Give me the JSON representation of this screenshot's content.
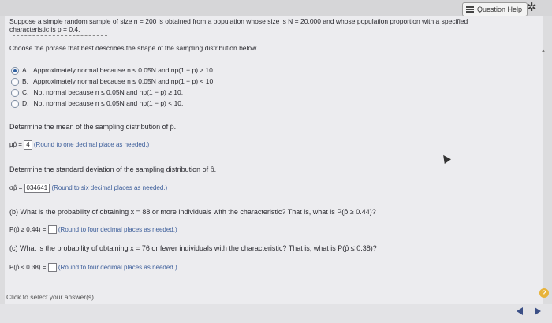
{
  "header": {
    "help_label": "Question Help"
  },
  "icons": {
    "menu": "list-icon",
    "gear": "gear-icon",
    "help": "question-icon",
    "prev": "left-arrow-icon",
    "next": "right-arrow-icon"
  },
  "intro": {
    "line1": "Suppose a simple random sample of size n = 200 is obtained from a population whose size is N = 20,000 and whose population proportion with a specified",
    "line2": "characteristic is p = 0.4."
  },
  "question_a": {
    "prompt": "Choose the phrase that best describes the shape of the sampling distribution below.",
    "options": [
      {
        "letter": "A.",
        "text": "Approximately normal because n ≤ 0.05N and np(1 − p) ≥ 10.",
        "selected": true
      },
      {
        "letter": "B.",
        "text": "Approximately normal because n ≤ 0.05N and np(1 − p) < 10.",
        "selected": false
      },
      {
        "letter": "C.",
        "text": "Not normal because n ≤ 0.05N and np(1 − p) ≥ 10.",
        "selected": false
      },
      {
        "letter": "D.",
        "text": "Not normal because n ≤ 0.05N and np(1 − p) < 10.",
        "selected": false
      }
    ],
    "mean_prompt": "Determine the mean of the sampling distribution of p̂.",
    "mean_symbol": "μp̂ =",
    "mean_value": "4",
    "mean_hint": "(Round to one decimal place as needed.)",
    "sd_prompt": "Determine the standard deviation of the sampling distribution of p̂.",
    "sd_symbol": "σp̂ =",
    "sd_value": "034641",
    "sd_hint": "(Round to six decimal places as needed.)"
  },
  "question_b": {
    "prompt": "(b) What is the probability of obtaining x = 88 or more individuals with the characteristic? That is, what is P(p̂ ≥ 0.44)?",
    "label": "P(p̂ ≥ 0.44) =",
    "hint": "(Round to four decimal places as needed.)"
  },
  "question_c": {
    "prompt": "(c) What is the probability of obtaining x = 76 or fewer individuals with the characteristic? That is, what is P(p̂ ≤ 0.38)?",
    "label": "P(p̂ ≤ 0.38) =",
    "hint": "(Round to four decimal places as needed.)"
  },
  "footer": {
    "click_message": "Click to select your answer(s)."
  }
}
